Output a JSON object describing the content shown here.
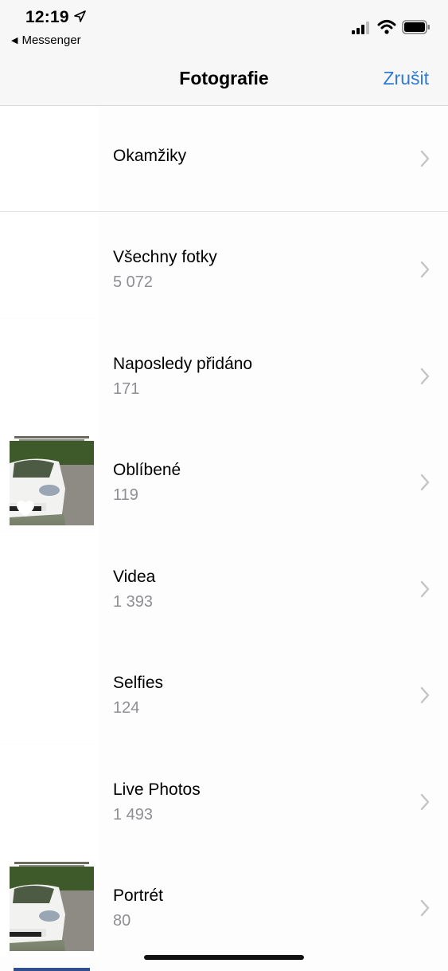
{
  "status": {
    "time": "12:19",
    "back_app": "Messenger"
  },
  "nav": {
    "title": "Fotografie",
    "cancel": "Zrušit"
  },
  "albums": [
    {
      "title": "Okamžiky",
      "count": ""
    },
    {
      "title": "Všechny fotky",
      "count": "5 072"
    },
    {
      "title": "Naposledy přidáno",
      "count": "171"
    },
    {
      "title": "Oblíbené",
      "count": "119"
    },
    {
      "title": "Videa",
      "count": "1 393"
    },
    {
      "title": "Selfies",
      "count": "124"
    },
    {
      "title": "Live Photos",
      "count": "1 493"
    },
    {
      "title": "Portrét",
      "count": "80"
    }
  ],
  "colors": {
    "accent": "#2f7bd6",
    "secondary_text": "#8e8e93"
  }
}
